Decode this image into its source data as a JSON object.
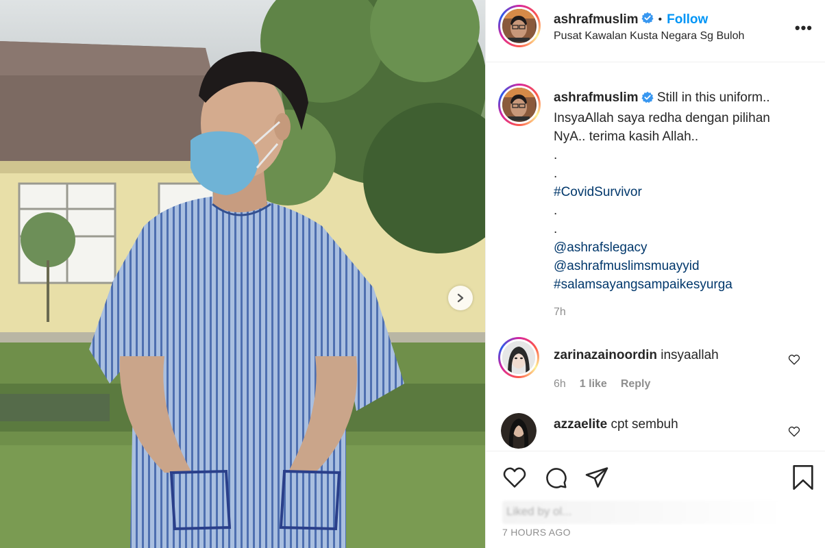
{
  "post": {
    "photo_alt": "",
    "has_next_slide": true
  },
  "header": {
    "username": "ashrafmuslim",
    "verified": true,
    "separator": "•",
    "follow_label": "Follow",
    "location": "Pusat Kawalan Kusta Negara Sg Buloh",
    "more_icon": "more-horizontal-icon",
    "more_label": "•••"
  },
  "caption": {
    "username": "ashrafmuslim",
    "text_line1": "Still in this uniform..",
    "text_line2": "InsyaAllah saya redha dengan pilihan",
    "text_line3": "NyA.. terima kasih Allah..",
    "dot1": ".",
    "dot2": ".",
    "hashtag1": "#CovidSurvivor",
    "dot3": ".",
    "dot4": ".",
    "mention1": "@ashrafslegacy",
    "mention2": "@ashrafmuslimsmuayyid",
    "hashtag2": "#salamsayangsampaikesyurga",
    "time": "7h"
  },
  "comments": [
    {
      "username": "zarinazainoordin",
      "text": "insyaallah",
      "time": "6h",
      "likes": "1 like",
      "reply": "Reply"
    },
    {
      "username": "azzaelite",
      "text": "cpt sembuh"
    }
  ],
  "actions": {
    "icons": [
      "heart-icon",
      "comment-icon",
      "share-icon",
      "bookmark-icon"
    ],
    "liked_by": "Liked by ol...",
    "post_time": "7 HOURS AGO"
  },
  "colors": {
    "link": "#00376b",
    "follow": "#0095f6",
    "verified": "#3897f0",
    "muted": "#8e8e8e"
  }
}
